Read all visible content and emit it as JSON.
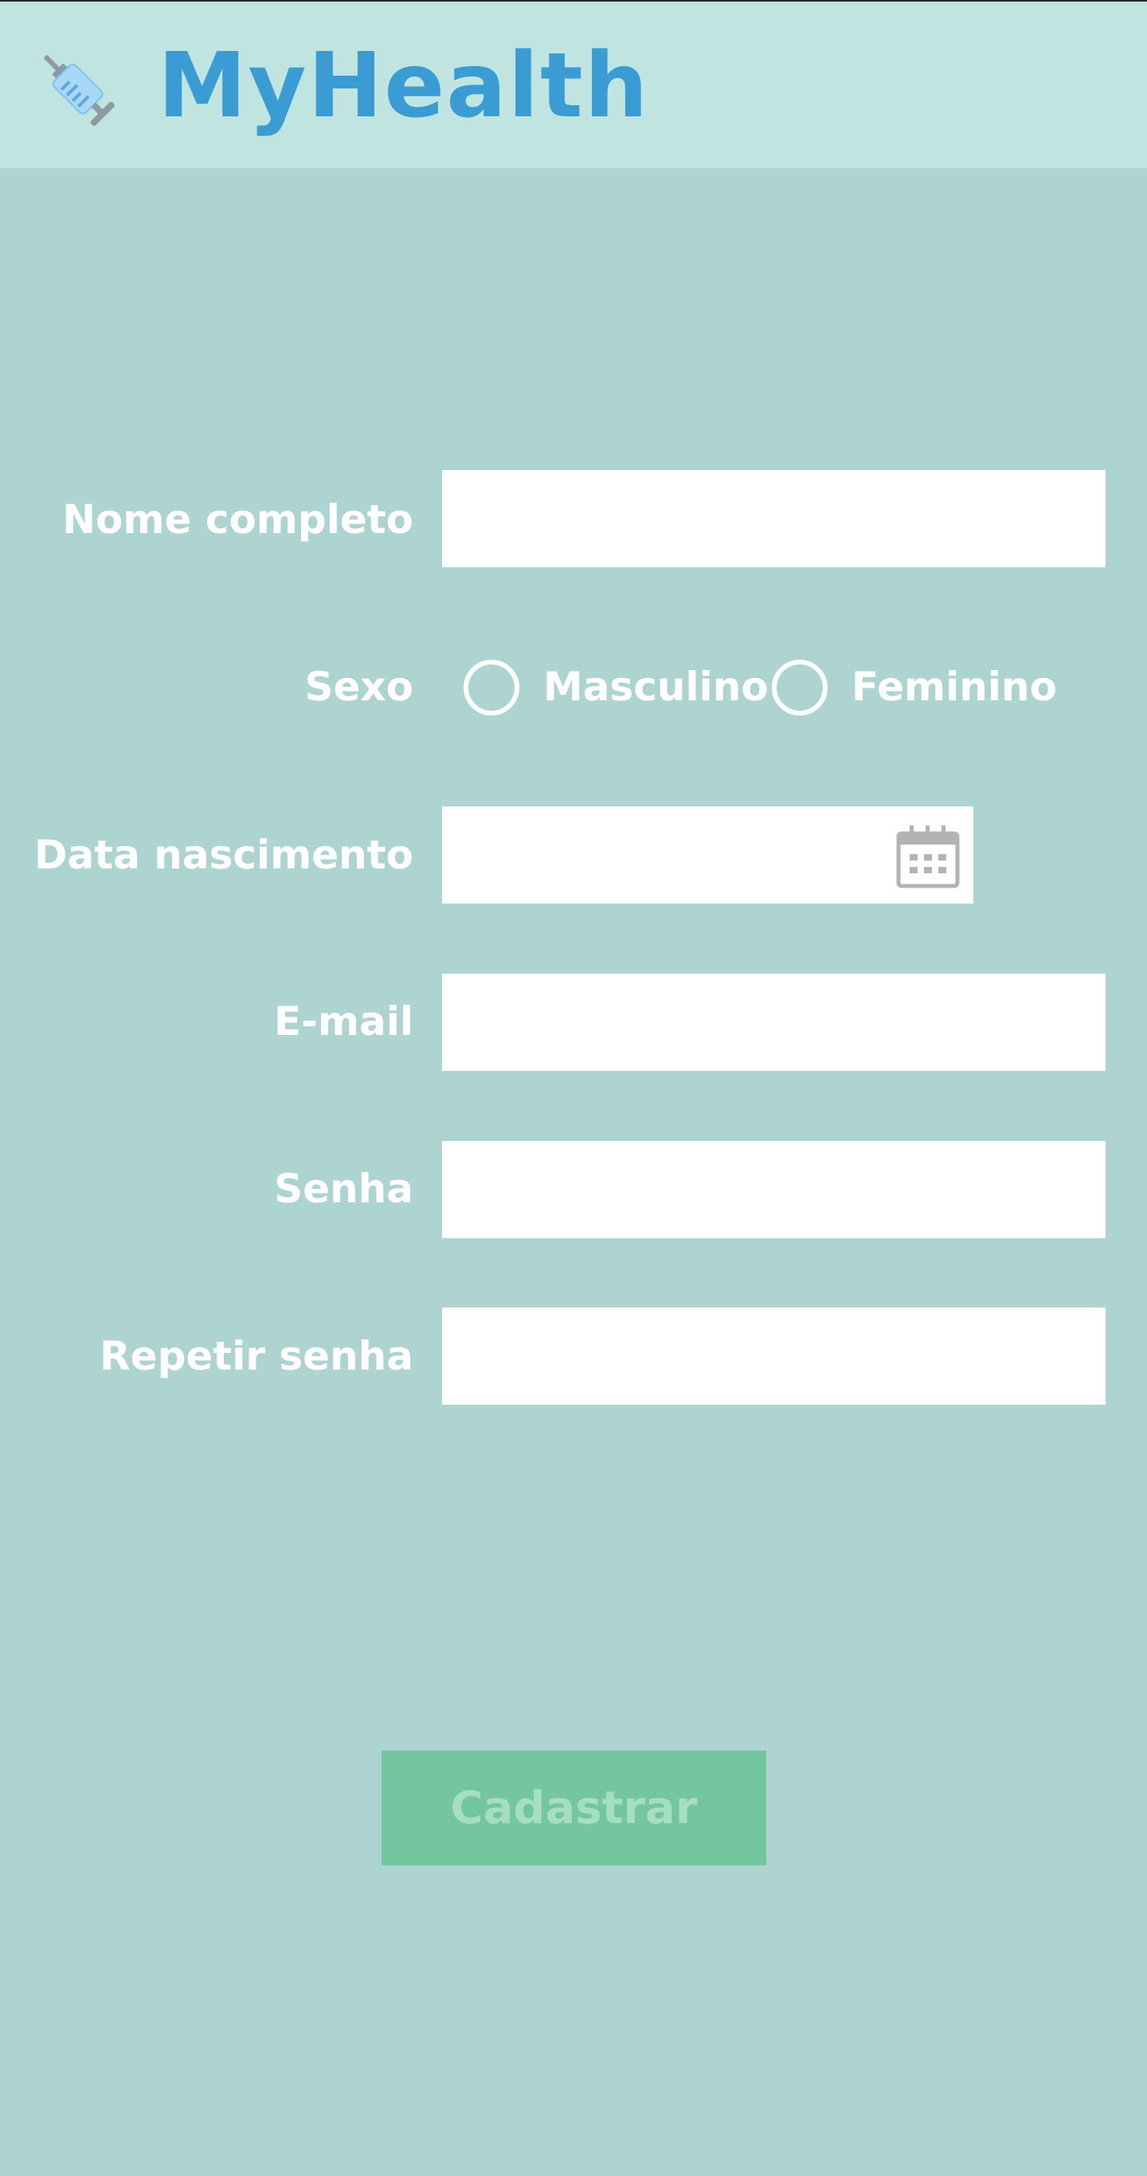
{
  "header": {
    "title": "MyHealth",
    "logo_icon": "syringe-icon"
  },
  "form": {
    "full_name": {
      "label": "Nome completo",
      "value": "",
      "placeholder": ""
    },
    "sex": {
      "label": "Sexo",
      "options": [
        {
          "label": "Masculino",
          "selected": false
        },
        {
          "label": "Feminino",
          "selected": false
        }
      ]
    },
    "birth_date": {
      "label": "Data nascimento",
      "value": "",
      "icon": "calendar-icon"
    },
    "email": {
      "label": "E-mail",
      "value": "",
      "placeholder": ""
    },
    "password": {
      "label": "Senha",
      "value": "",
      "placeholder": ""
    },
    "repeat_password": {
      "label": "Repetir senha",
      "value": "",
      "placeholder": ""
    },
    "submit_label": "Cadastrar"
  },
  "colors": {
    "background": "#add4d1",
    "header_background": "#c0e5e0",
    "title": "#3b9bd3",
    "button": "#73c69e",
    "button_text": "#a6dfc0"
  }
}
